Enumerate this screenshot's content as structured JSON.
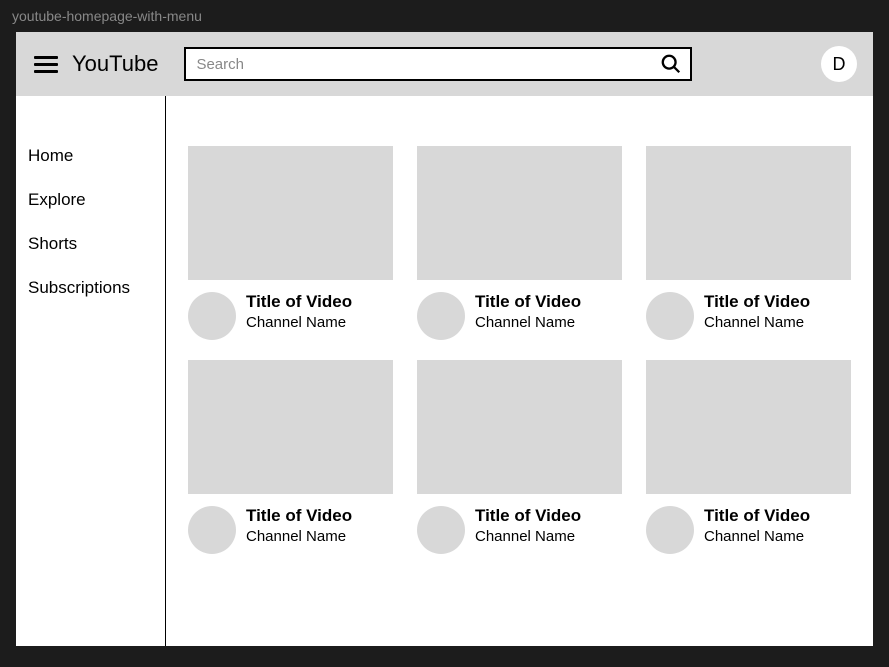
{
  "window": {
    "title": "youtube-homepage-with-menu"
  },
  "header": {
    "brand": "YouTube",
    "search_placeholder": "Search",
    "avatar_initial": "D"
  },
  "sidebar": {
    "items": [
      {
        "label": "Home"
      },
      {
        "label": "Explore"
      },
      {
        "label": "Shorts"
      },
      {
        "label": "Subscriptions"
      }
    ]
  },
  "videos": [
    {
      "title": "Title of Video",
      "channel": "Channel Name"
    },
    {
      "title": "Title of Video",
      "channel": "Channel Name"
    },
    {
      "title": "Title of Video",
      "channel": "Channel Name"
    },
    {
      "title": "Title of Video",
      "channel": "Channel Name"
    },
    {
      "title": "Title of Video",
      "channel": "Channel Name"
    },
    {
      "title": "Title of Video",
      "channel": "Channel Name"
    }
  ]
}
